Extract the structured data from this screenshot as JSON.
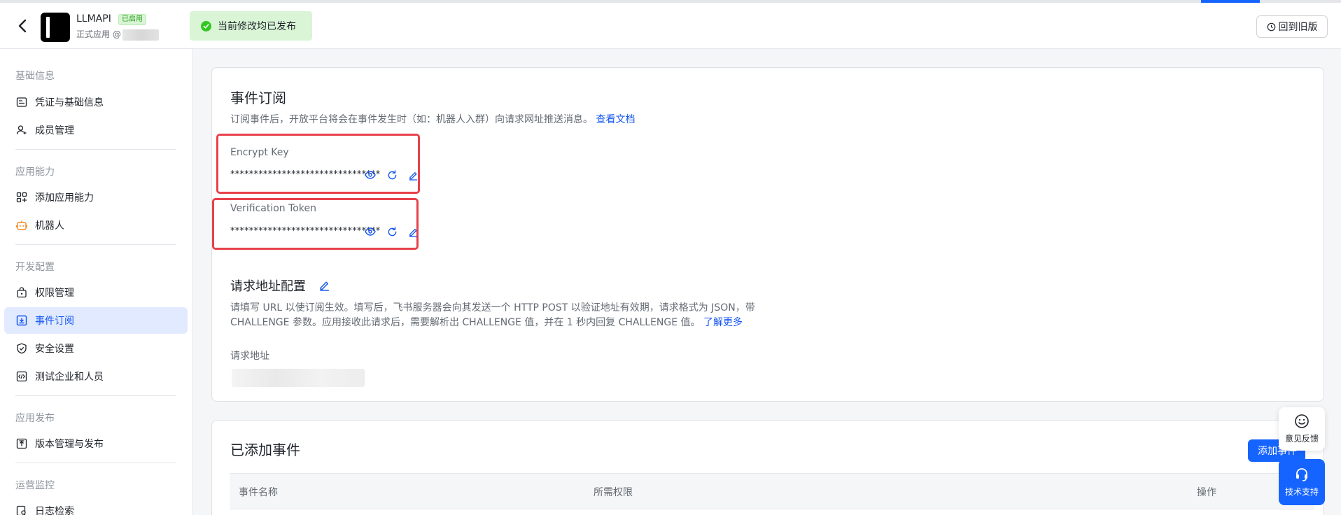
{
  "header": {
    "app_name": "LLMAPI",
    "app_badge": "已启用",
    "app_sub": "正式应用 @",
    "publish_status": "当前修改均已发布",
    "old_version_label": "回到旧版"
  },
  "sidebar": {
    "groups": {
      "basic": "基础信息",
      "ability": "应用能力",
      "dev": "开发配置",
      "release": "应用发布",
      "ops": "运营监控"
    },
    "items": {
      "credentials": "凭证与基础信息",
      "members": "成员管理",
      "add_ability": "添加应用能力",
      "robot": "机器人",
      "permissions": "权限管理",
      "events": "事件订阅",
      "security": "安全设置",
      "test_tenant": "测试企业和人员",
      "version": "版本管理与发布",
      "logs": "日志检索"
    }
  },
  "event_sub": {
    "title": "事件订阅",
    "desc": "订阅事件后，开放平台将会在事件发生时（如：机器人入群）向请求网址推送消息。",
    "doc_link": "查看文档",
    "encrypt_key_label": "Encrypt Key",
    "encrypt_key_value": "********************************",
    "verification_token_label": "Verification Token",
    "verification_token_value": "********************************"
  },
  "request_config": {
    "title": "请求地址配置",
    "desc_line1": "请填写 URL 以使订阅生效。填写后，飞书服务器会向其发送一个 HTTP POST 以验证地址有效期，请求格式为 JSON，带",
    "desc_line2": "CHALLENGE 参数。应用接收此请求后，需要解析出 CHALLENGE 值，并在 1 秒内回复 CHALLENGE 值。",
    "learn_more": "了解更多",
    "url_label": "请求地址"
  },
  "added_events": {
    "title": "已添加事件",
    "add_button": "添加事件",
    "columns": [
      "事件名称",
      "所需权限",
      "操作"
    ]
  },
  "floating": {
    "feedback": "意见反馈",
    "support": "技术支持"
  },
  "colors": {
    "accent": "#1664ff",
    "success": "#34c724",
    "highlight_border": "#e8414a"
  }
}
